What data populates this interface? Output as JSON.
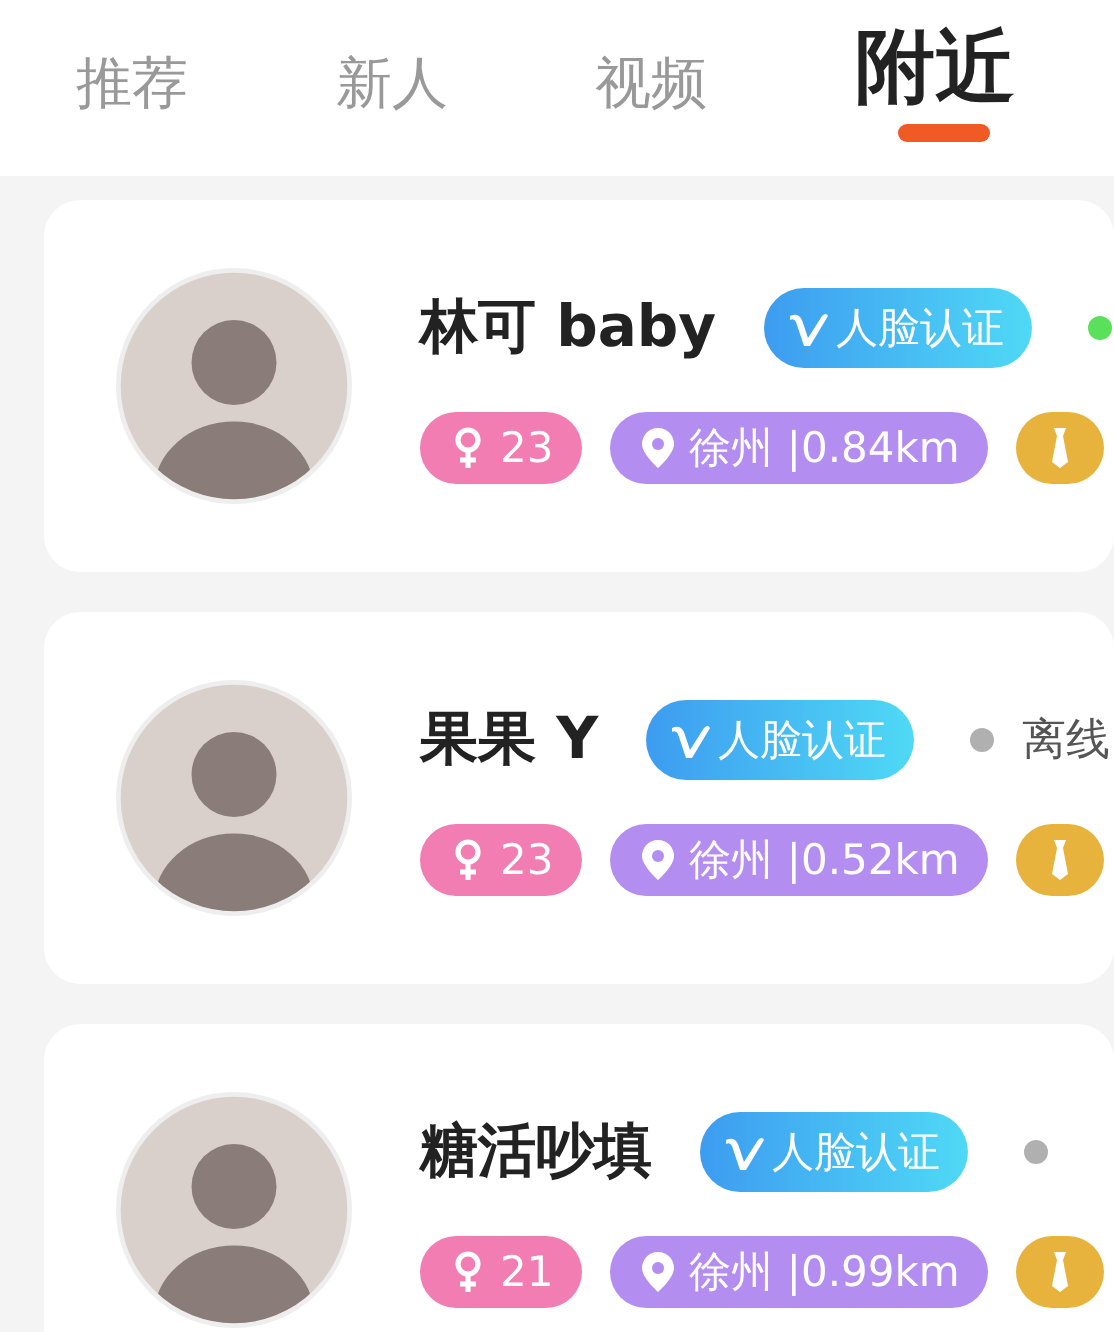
{
  "tabs": [
    {
      "label": "推荐",
      "selected": false
    },
    {
      "label": "新人",
      "selected": false
    },
    {
      "label": "视频",
      "selected": false
    },
    {
      "label": "附近",
      "selected": true
    }
  ],
  "users": [
    {
      "name": "林可 baby",
      "badge": "人脸认证",
      "online": true,
      "age": "23",
      "location": "徐州 |0.84km"
    },
    {
      "name": "果果 Y",
      "badge": "人脸认证",
      "online": false,
      "status": "离线",
      "age": "23",
      "location": "徐州 |0.52km"
    },
    {
      "name": "糖活吵填",
      "badge": "人脸认证",
      "online": false,
      "age": "21",
      "location": "徐州 |0.99km"
    }
  ]
}
